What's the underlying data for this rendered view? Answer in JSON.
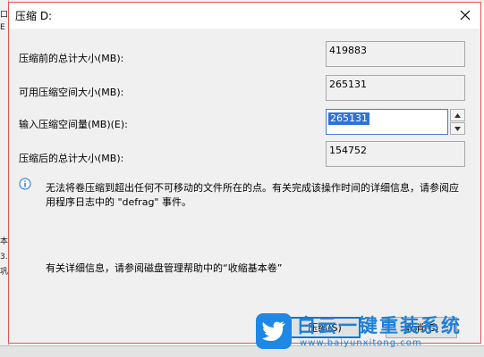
{
  "window": {
    "title": "压缩 D:"
  },
  "fields": {
    "total_before": {
      "label": "压缩前的总计大小(MB):",
      "value": "419883"
    },
    "available": {
      "label": "可用压缩空间大小(MB):",
      "value": "265131"
    },
    "enter_amount": {
      "label": "输入压缩空间量(MB)(E):",
      "value": "265131"
    },
    "total_after": {
      "label": "压缩后的总计大小(MB):",
      "value": "154752"
    }
  },
  "info_message": "无法将卷压缩到超出任何不可移动的文件所在的点。有关完成该操作时间的详细信息，请参阅应用程序日志中的 \"defrag\" 事件。",
  "help_message": "有关详细信息，请参阅磁盘管理帮助中的“收缩基本卷”",
  "buttons": {
    "shrink": "压缩(S)",
    "cancel": "取消(C)"
  },
  "watermark": {
    "title": "白云一键重装系统",
    "url": "www.baiyunxitong.com"
  },
  "background_fragments": [
    "口",
    "E",
    "本",
    "3.",
    "巩"
  ],
  "colors": {
    "accent": "#0078d7",
    "selection": "#3272d4",
    "dialog_border": "#e0554f",
    "watermark": "#1e7fd8"
  }
}
